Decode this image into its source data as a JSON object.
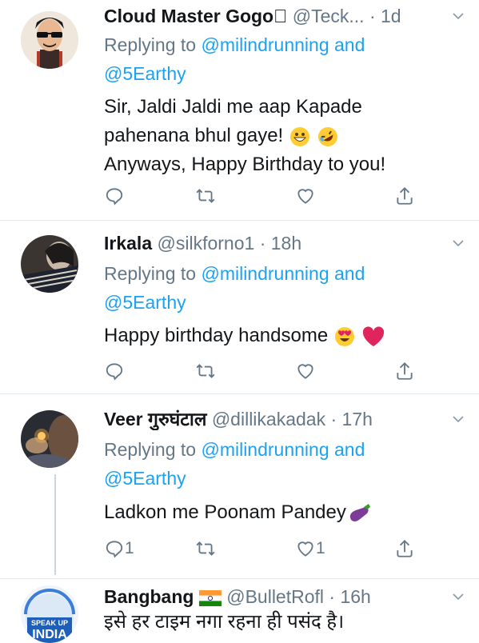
{
  "tweets": [
    {
      "name": "Cloud Master Gogo",
      "name_suffix": "⃞",
      "handle": "@Teck...",
      "time": "· 1d",
      "replying_prefix": "Replying to ",
      "replying_user": "@milindrunning and",
      "replying_user2": "@5Earthy",
      "text_line1": "Sir, Jaldi Jaldi me aap Kapade",
      "text_line2": "pahenana bhul gaye!",
      "text_line3": "Anyways, Happy Birthday to you!",
      "reply_count": "",
      "retweet_count": "",
      "like_count": ""
    },
    {
      "name": "Irkala",
      "handle": "@silkforno1",
      "time": "· 18h",
      "replying_prefix": "Replying to ",
      "replying_user": "@milindrunning and",
      "replying_user2": "@5Earthy",
      "text_line1": "Happy birthday handsome",
      "reply_count": "",
      "retweet_count": "",
      "like_count": ""
    },
    {
      "name": "Veer गुरुघंटाल",
      "handle": "@dillikakadak",
      "time": "· 17h",
      "replying_prefix": "Replying to ",
      "replying_user": "@milindrunning and",
      "replying_user2": "@5Earthy",
      "text_line1": "Ladkon me Poonam Pandey",
      "reply_count": "1",
      "retweet_count": "",
      "like_count": "1"
    },
    {
      "name": "Bangbang",
      "handle": "@BulletRofl",
      "time": "· 16h",
      "text_line1": "इसे हर टाइम नगा रहना ही पसंद है।",
      "avatar_text1": "SPEAK UP",
      "avatar_text2": "INDIA"
    }
  ],
  "colors": {
    "link": "#1da1f2",
    "muted": "#657786",
    "text": "#14171a",
    "divider": "#e1e8ed"
  },
  "icons": [
    "reply-icon",
    "retweet-icon",
    "like-icon",
    "share-icon",
    "caret-down-icon"
  ]
}
